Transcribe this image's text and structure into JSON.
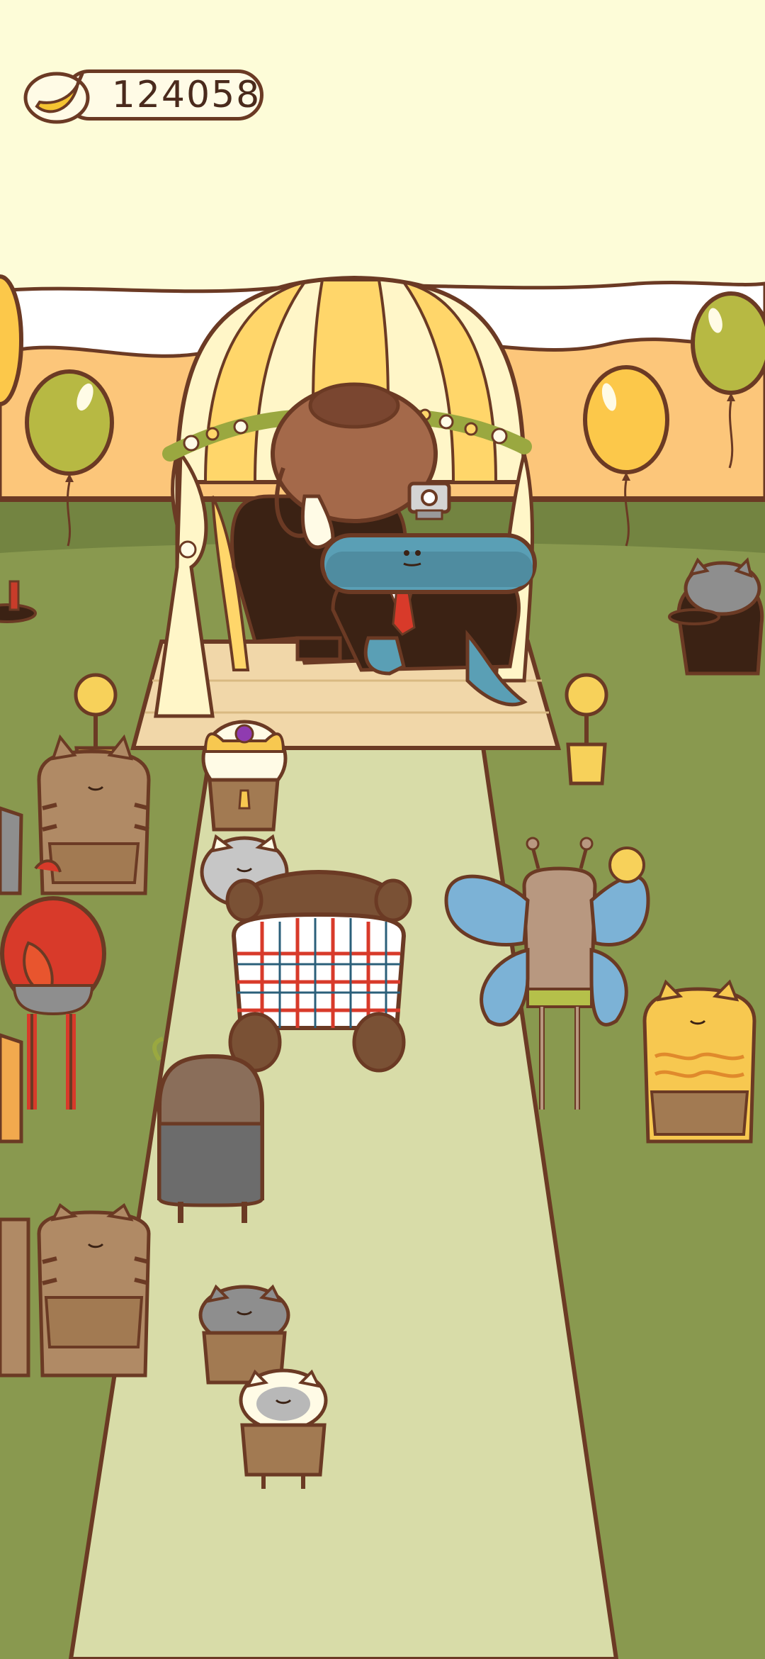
{
  "hud": {
    "currency_icon": "banana-icon",
    "currency_value": "124058"
  },
  "colors": {
    "sky": "#fdfcd8",
    "hills": "#fcc67a",
    "grass": "#89994f",
    "aisle": "#d8dca8",
    "outline": "#6b3a24",
    "balloon_green": "#b7b943",
    "balloon_yellow": "#fcc84a"
  }
}
